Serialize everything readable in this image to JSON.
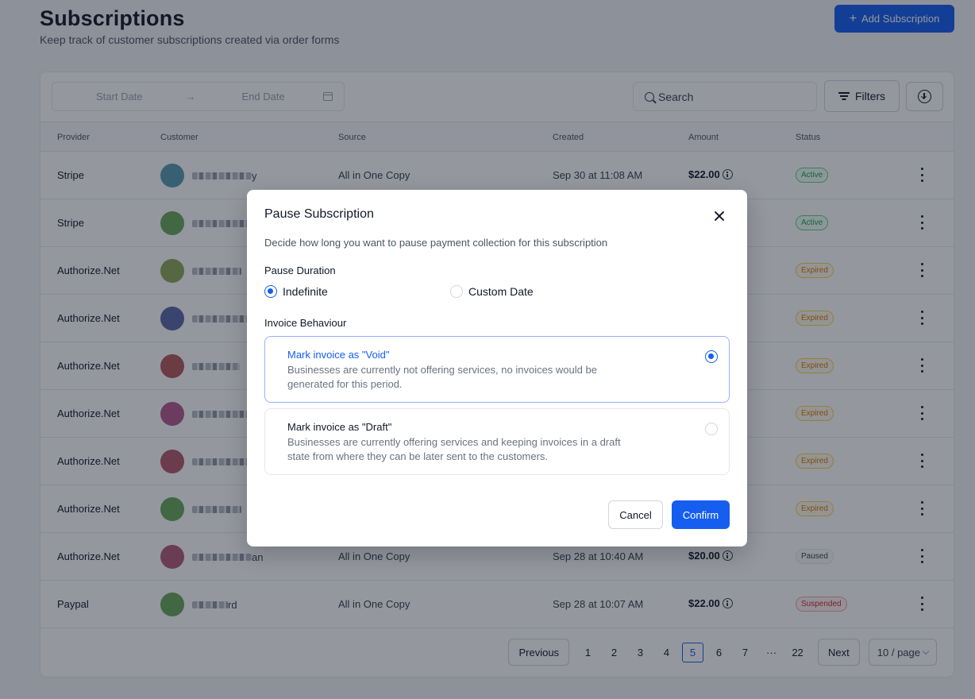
{
  "page": {
    "title": "Subscriptions",
    "subtitle": "Keep track of customer subscriptions created via order forms",
    "add_button": "Add Subscription"
  },
  "toolbar": {
    "start_date_placeholder": "Start Date",
    "arrow": "→",
    "end_date_placeholder": "End Date",
    "search_placeholder": "Search",
    "filters_label": "Filters"
  },
  "table": {
    "columns": [
      "Provider",
      "Customer",
      "Source",
      "Created",
      "Amount",
      "Status"
    ],
    "rows": [
      {
        "provider": "Stripe",
        "customer_tail": "y",
        "source": "All in One Copy",
        "created": "Sep 30 at 11:08 AM",
        "amount": "$22.00",
        "status": "Active",
        "status_kind": "active",
        "avatar_color": "#5a9bb0"
      },
      {
        "provider": "Stripe",
        "customer_tail": "",
        "source": "",
        "created": "",
        "amount": "",
        "status": "Active",
        "status_kind": "active",
        "avatar_color": "#6aa85a"
      },
      {
        "provider": "Authorize.Net",
        "customer_tail": "",
        "source": "",
        "created": "",
        "amount": "",
        "status": "Expired",
        "status_kind": "expired",
        "avatar_color": "#8fa85a"
      },
      {
        "provider": "Authorize.Net",
        "customer_tail": "",
        "source": "",
        "created": "",
        "amount": "",
        "status": "Expired",
        "status_kind": "expired",
        "avatar_color": "#5a6aa8"
      },
      {
        "provider": "Authorize.Net",
        "customer_tail": "",
        "source": "",
        "created": "",
        "amount": "",
        "status": "Expired",
        "status_kind": "expired",
        "avatar_color": "#b55a5a"
      },
      {
        "provider": "Authorize.Net",
        "customer_tail": "",
        "source": "",
        "created": "",
        "amount": "",
        "status": "Expired",
        "status_kind": "expired",
        "avatar_color": "#b55a8f"
      },
      {
        "provider": "Authorize.Net",
        "customer_tail": "",
        "source": "",
        "created": "",
        "amount": "",
        "status": "Expired",
        "status_kind": "expired",
        "avatar_color": "#b55a6a"
      },
      {
        "provider": "Authorize.Net",
        "customer_tail": "",
        "source": "",
        "created": "",
        "amount": "",
        "status": "Expired",
        "status_kind": "expired",
        "avatar_color": "#6aa85a"
      },
      {
        "provider": "Authorize.Net",
        "customer_tail": "an",
        "source": "All in One Copy",
        "created": "Sep 28 at 10:40 AM",
        "amount": "$20.00",
        "status": "Paused",
        "status_kind": "paused",
        "avatar_color": "#b55a7a"
      },
      {
        "provider": "Paypal",
        "customer_tail": "rd",
        "source": "All in One Copy",
        "created": "Sep 28 at 10:07 AM",
        "amount": "$22.00",
        "status": "Suspended",
        "status_kind": "suspended",
        "avatar_color": "#6aa85a"
      }
    ]
  },
  "pagination": {
    "previous": "Previous",
    "next": "Next",
    "pages": [
      "1",
      "2",
      "3",
      "4",
      "5",
      "6",
      "7",
      "···",
      "22"
    ],
    "current": "5",
    "per_page": "10 / page"
  },
  "modal": {
    "title": "Pause Subscription",
    "description": "Decide how long you want to pause payment collection for this subscription",
    "duration_label": "Pause Duration",
    "duration_options": [
      {
        "label": "Indefinite",
        "selected": true
      },
      {
        "label": "Custom Date",
        "selected": false
      }
    ],
    "invoice_label": "Invoice Behaviour",
    "invoice_options": [
      {
        "title": "Mark invoice as \"Void\"",
        "description": "Businesses are currently not offering services, no invoices would be generated for this period.",
        "selected": true
      },
      {
        "title": "Mark invoice as \"Draft\"",
        "description": "Businesses are currently offering services and keeping invoices in a draft state from where they can be later sent to the customers.",
        "selected": false
      }
    ],
    "cancel": "Cancel",
    "confirm": "Confirm"
  },
  "colors": {
    "primary": "#155eef"
  }
}
